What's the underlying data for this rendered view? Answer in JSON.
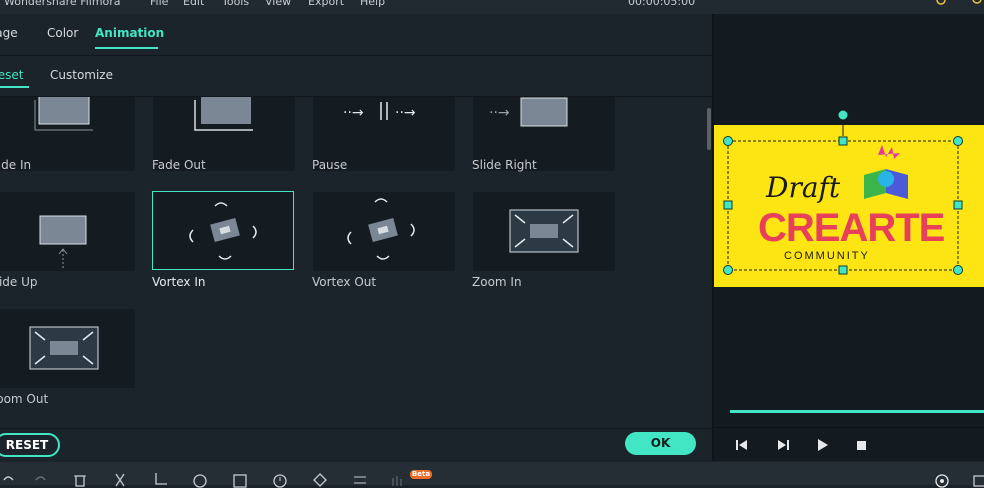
{
  "menubar": {
    "app_title": "Wondershare Filmora",
    "items": [
      "File",
      "Edit",
      "Tools",
      "View",
      "Export",
      "Help"
    ],
    "timecode": "00:00:05:00"
  },
  "tabs": [
    "Image",
    "Color",
    "Animation"
  ],
  "active_tab": "Animation",
  "subtabs": [
    "Preset",
    "Customize"
  ],
  "active_subtab": "Preset",
  "presets": [
    {
      "label": "Fade In",
      "icon": "fade-in-thumbnail"
    },
    {
      "label": "Fade Out",
      "icon": "fade-out-thumbnail"
    },
    {
      "label": "Pause",
      "icon": "pause-thumbnail"
    },
    {
      "label": "Slide Right",
      "icon": "slide-right-thumbnail"
    },
    {
      "label": "Slide Up",
      "icon": "slide-up-thumbnail"
    },
    {
      "label": "Vortex In",
      "icon": "vortex-in-thumbnail"
    },
    {
      "label": "Vortex Out",
      "icon": "vortex-out-thumbnail"
    },
    {
      "label": "Zoom In",
      "icon": "zoom-in-thumbnail"
    },
    {
      "label": "Zoom Out",
      "icon": "zoom-out-thumbnail"
    }
  ],
  "selected_preset": "Vortex In",
  "buttons": {
    "reset": "RESET",
    "ok": "OK"
  },
  "preview": {
    "logo_word1": "Draft",
    "logo_word2": "CREARTE",
    "logo_word3": "COMMUNITY",
    "background_color": "#fde514"
  },
  "toolbar": {
    "beta_badge": "Beta"
  },
  "colors": {
    "accent": "#42e6c5",
    "panel": "#1c242b",
    "tile": "#141b21"
  }
}
